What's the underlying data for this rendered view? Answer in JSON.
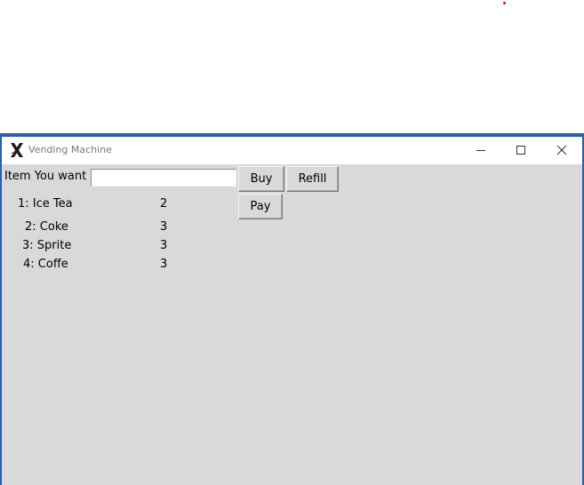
{
  "window": {
    "title": "Vending Machine",
    "app_icon": "x11-icon"
  },
  "form": {
    "item_label": "Item You want",
    "item_input_value": "",
    "buy_label": "Buy",
    "refill_label": "Refill",
    "pay_label": "Pay"
  },
  "items": [
    {
      "name": "1: Ice Tea",
      "count": "2"
    },
    {
      "name": "2: Coke",
      "count": "3"
    },
    {
      "name": "3: Sprite",
      "count": "3"
    },
    {
      "name": "4: Coffe",
      "count": "3"
    }
  ],
  "colors": {
    "window_border": "#2a5fa8",
    "client_bg": "#d9d9d9"
  }
}
